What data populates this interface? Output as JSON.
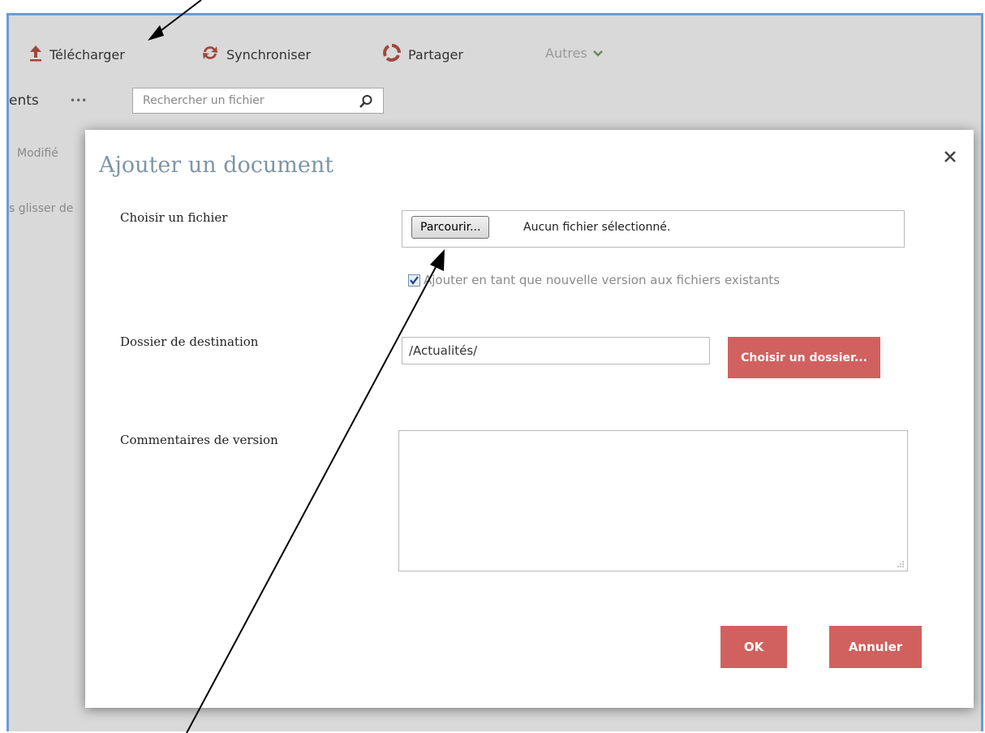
{
  "toolbar": {
    "upload_label": "Télécharger",
    "sync_label": "Synchroniser",
    "share_label": "Partager",
    "more_label": "Autres"
  },
  "list_header": {
    "partial_title": "ents",
    "more_dots": "•••",
    "search_placeholder": "Rechercher un fichier",
    "modified_column": "Modifié",
    "drag_hint": "s glisser de"
  },
  "dialog": {
    "title": "Ajouter un document",
    "choose_file_label": "Choisir un fichier",
    "browse_button": "Parcourir...",
    "no_file_text": "Aucun fichier sélectionné.",
    "new_version_checkbox_label": "Ajouter en tant que nouvelle version aux fichiers existants",
    "new_version_checked": true,
    "destination_label": "Dossier de destination",
    "destination_value": "/Actualités/",
    "choose_folder_button": "Choisir un dossier...",
    "comments_label": "Commentaires de version",
    "comments_value": "",
    "ok_button": "OK",
    "cancel_button": "Annuler"
  },
  "colors": {
    "accent_red": "#d0615e",
    "title_blue_gray": "#7d96a8",
    "window_border": "#6b9bd2",
    "toolbar_icon_brown": "#a0473d"
  }
}
